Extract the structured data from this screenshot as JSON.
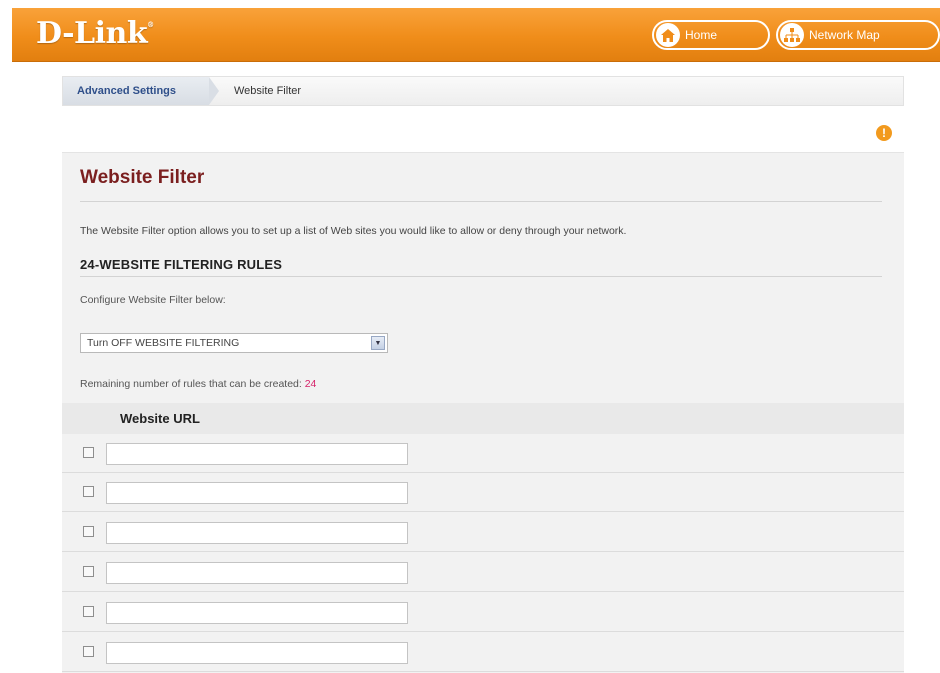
{
  "header": {
    "logo_text": "D-Link",
    "logo_reg": "®",
    "home_label": "Home",
    "network_map_label": "Network Map"
  },
  "breadcrumb": {
    "section": "Advanced Settings",
    "page": "Website Filter"
  },
  "help_icon": "help-icon",
  "main": {
    "title": "Website Filter",
    "description": "The Website Filter option allows you to set up a list of Web sites you would like to allow or deny through your network.",
    "rules_heading": "24-WEBSITE FILTERING RULES",
    "configure_label": "Configure Website Filter below:",
    "filter_select_value": "Turn OFF WEBSITE FILTERING",
    "remaining_label": "Remaining number of rules that can be created:",
    "remaining_count": "24",
    "table_header": "Website URL",
    "rows": [
      {
        "checked": false,
        "url": ""
      },
      {
        "checked": false,
        "url": ""
      },
      {
        "checked": false,
        "url": ""
      },
      {
        "checked": false,
        "url": ""
      },
      {
        "checked": false,
        "url": ""
      },
      {
        "checked": false,
        "url": ""
      }
    ]
  },
  "colors": {
    "brand_orange": "#f08d1a",
    "title_maroon": "#7b1f1f",
    "count_pink": "#d6246a"
  }
}
